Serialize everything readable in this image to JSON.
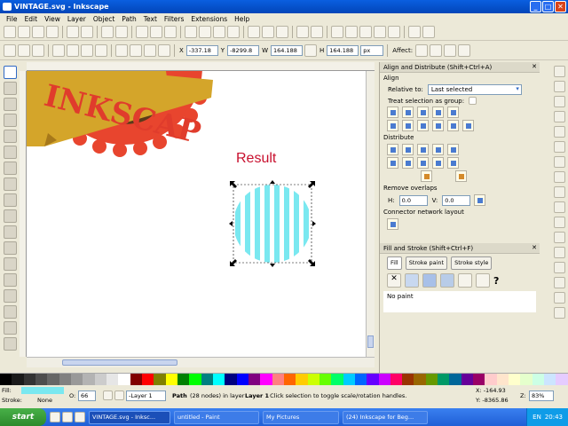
{
  "window": {
    "title": "VINTAGE.svg - Inkscape"
  },
  "menu": [
    "File",
    "Edit",
    "View",
    "Layer",
    "Object",
    "Path",
    "Text",
    "Filters",
    "Extensions",
    "Help"
  ],
  "toolctrl": {
    "x_label": "X",
    "x_value": "-337.18",
    "y_label": "Y",
    "y_value": "-8299.8",
    "w_label": "W",
    "w_value": "164.188",
    "h_label": "H",
    "h_value": "164.188",
    "units": "px",
    "affect_label": "Affect:"
  },
  "canvas": {
    "logo_text": "INKSCAP",
    "result_label": "Result",
    "colors": {
      "stripe": "#7ae8f0",
      "badge": "#e8452e",
      "banner": "#d4a52a",
      "result": "#c8102e"
    }
  },
  "align_panel": {
    "title": "Align and Distribute (Shift+Ctrl+A)",
    "align_heading": "Align",
    "relative_to_label": "Relative to:",
    "relative_to_value": "Last selected",
    "treat_group_label": "Treat selection as group:",
    "distribute_heading": "Distribute",
    "remove_overlaps_heading": "Remove overlaps",
    "h_label": "H:",
    "h_value": "0.0",
    "v_label": "V:",
    "v_value": "0.0",
    "connector_heading": "Connector network layout"
  },
  "fill_panel": {
    "title": "Fill and Stroke (Shift+Ctrl+F)",
    "tabs": [
      "Fill",
      "Stroke paint",
      "Stroke style"
    ],
    "no_paint": "No paint",
    "unset_glyph": "✕",
    "unknown_glyph": "?"
  },
  "status": {
    "fill_label": "Fill:",
    "stroke_label": "Stroke:",
    "stroke_value": "None",
    "opacity_label": "O:",
    "opacity_value": "66",
    "layer_value": "-Layer 1",
    "message_bold": "Path",
    "message_rest": " (28 nodes) in layer ",
    "message_layer": "Layer 1",
    "message_tail": ". Click selection to toggle scale/rotation handles.",
    "x_coord": "X: -164.93",
    "y_coord": "Y: -8365.86",
    "zoom_label": "Z:",
    "zoom_value": "83%"
  },
  "taskbar": {
    "start": "start",
    "tasks": [
      "VINTAGE.svg - Inksc...",
      "untitled - Paint",
      "My Pictures",
      "(24) Inkscape for Beg..."
    ],
    "lang": "EN",
    "clock": "20:43"
  },
  "palette_colors": [
    "#000000",
    "#1a1a1a",
    "#333333",
    "#4d4d4d",
    "#666666",
    "#808080",
    "#999999",
    "#b3b3b3",
    "#cccccc",
    "#e6e6e6",
    "#ffffff",
    "#800000",
    "#ff0000",
    "#808000",
    "#ffff00",
    "#008000",
    "#00ff00",
    "#008080",
    "#00ffff",
    "#000080",
    "#0000ff",
    "#800080",
    "#ff00ff",
    "#ff8080",
    "#ff6600",
    "#ffcc00",
    "#ccff00",
    "#66ff00",
    "#00ff66",
    "#00ccff",
    "#0066ff",
    "#6600ff",
    "#cc00ff",
    "#ff0066",
    "#993300",
    "#996600",
    "#669900",
    "#009966",
    "#006699",
    "#660099",
    "#990066",
    "#ffcccc",
    "#ffe5cc",
    "#ffffcc",
    "#e5ffcc",
    "#ccffe5",
    "#cce5ff",
    "#e5ccff"
  ]
}
